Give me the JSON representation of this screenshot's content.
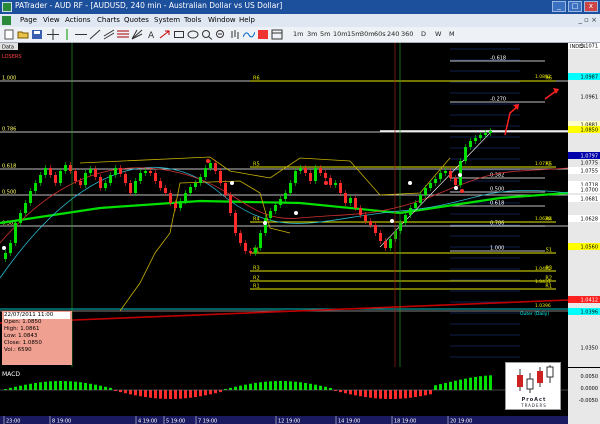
{
  "window": {
    "title": "PATrader - AUD RF - [AUDUSD, 240 min - Australian Dollar vs US Dollar]",
    "buttons": [
      "_",
      "□",
      "x"
    ]
  },
  "menu": {
    "items": [
      "Page",
      "View",
      "Actions",
      "Charts",
      "Quotes",
      "System",
      "Tools",
      "Window",
      "Help"
    ]
  },
  "toolbar": {
    "timeframes": [
      "1m",
      "3m",
      "5m",
      "10m",
      "15m",
      "30m",
      "60s",
      "240",
      "360",
      "D",
      "W",
      "M"
    ]
  },
  "chart": {
    "data_label": "Data",
    "indicator_label": "LOSERS",
    "symbol_tag": "INDEX",
    "fib_left": [
      "1.000",
      "0.786",
      "0.618",
      "0.500",
      "0.382"
    ],
    "fib_right": [
      "-0.618",
      "-0.270",
      "0.382",
      "0.500",
      "0.618",
      "0.786",
      "1.000"
    ],
    "pivots": [
      "R6",
      "R5",
      "R4",
      "R3",
      "R2",
      "R1",
      "S1"
    ],
    "pivot_value_labels": [
      "1.0892",
      "1.0773",
      "1.0626",
      "1.0485",
      "1.0431",
      "1.0396"
    ],
    "outer_label": "Outer (Daily)",
    "price_axis": {
      "labels": [
        "1.1071",
        "1.0987",
        "1.0961",
        "1.0881",
        "1.0850",
        "1.0797",
        "1.0775",
        "1.0755",
        "1.0718",
        "1.0700",
        "1.0681",
        "1.0628",
        "1.0560",
        "1.0412",
        "1.0396",
        "1.0350"
      ],
      "current_price": "1.0850",
      "highlight_colors": {
        "1.1071": "#ffffff",
        "1.0987": "#00ffff",
        "1.0881": "#ffffcc",
        "1.0850": "#ffff00",
        "1.0797": "#0000aa",
        "1.0755": "#ffffff",
        "1.0718": "#ffffff",
        "1.0700": "#ffffff",
        "1.0681": "#ffffff",
        "1.0628": "#ffffff",
        "1.0560": "#ffff00",
        "1.0412": "#ff2020",
        "1.0396": "#00ffff"
      }
    },
    "time_axis": [
      "23:00",
      "8 19:00",
      "4 19:00",
      "5 19:00",
      "7 19:00",
      "12 19:00",
      "14 19:00",
      "18 19:00",
      "20 19:00"
    ]
  },
  "ohlc_box": {
    "date": "22/07/2011 11:00",
    "open": "Open: 1.0850",
    "high": "High: 1.0861",
    "low": "Low: 1.0843",
    "close": "Close: 1.0850",
    "vol": "Vol.: 6590"
  },
  "macd": {
    "label": "MACD",
    "axis": [
      "0.0050",
      "0.0000",
      "-0.0050"
    ]
  },
  "logo": {
    "name": "ProAct",
    "sub": "TRADERS"
  },
  "colors": {
    "bull": "#00e000",
    "bear": "#ff2a2a",
    "pivot": "#e8e800",
    "fib": "#ffffff",
    "title_bar": "#1c4f9c"
  }
}
